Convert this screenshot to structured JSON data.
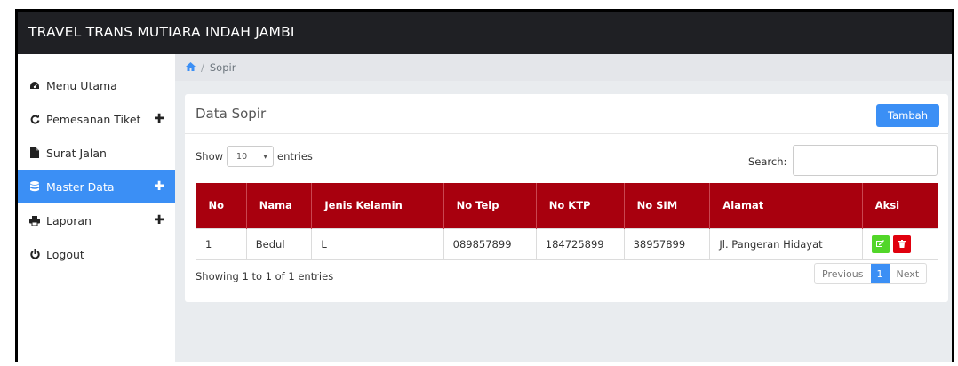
{
  "app": {
    "title": "TRAVEL TRANS MUTIARA INDAH JAMBI"
  },
  "sidebar": {
    "items": [
      {
        "label": "Menu Utama",
        "icon": "dashboard-icon",
        "expandable": false,
        "active": false
      },
      {
        "label": "Pemesanan Tiket",
        "icon": "refresh-icon",
        "expandable": true,
        "active": false
      },
      {
        "label": "Surat Jalan",
        "icon": "file-icon",
        "expandable": false,
        "active": false
      },
      {
        "label": "Master Data",
        "icon": "database-icon",
        "expandable": true,
        "active": true
      },
      {
        "label": "Laporan",
        "icon": "print-icon",
        "expandable": true,
        "active": false
      },
      {
        "label": "Logout",
        "icon": "power-icon",
        "expandable": false,
        "active": false
      }
    ]
  },
  "breadcrumb": {
    "home_icon": "home-icon",
    "current": "Sopir"
  },
  "card": {
    "title": "Data Sopir",
    "add_button": "Tambah",
    "show_label": "Show",
    "entries_value": "10",
    "entries_label": "entries",
    "search_label": "Search:",
    "search_value": ""
  },
  "table": {
    "columns": [
      "No",
      "Nama",
      "Jenis Kelamin",
      "No Telp",
      "No KTP",
      "No SIM",
      "Alamat",
      "Aksi"
    ],
    "rows": [
      [
        "1",
        "Bedul",
        "L",
        "089857899",
        "184725899",
        "38957899",
        "Jl. Pangeran Hidayat"
      ]
    ]
  },
  "footer": {
    "info": "Showing 1 to 1 of 1 entries",
    "prev": "Previous",
    "page": "1",
    "next": "Next"
  },
  "colors": {
    "accent": "#3b8ff5",
    "header_red": "#a8000e",
    "edit_green": "#52d629",
    "delete_red": "#e0000e",
    "topbar": "#1f2024"
  }
}
